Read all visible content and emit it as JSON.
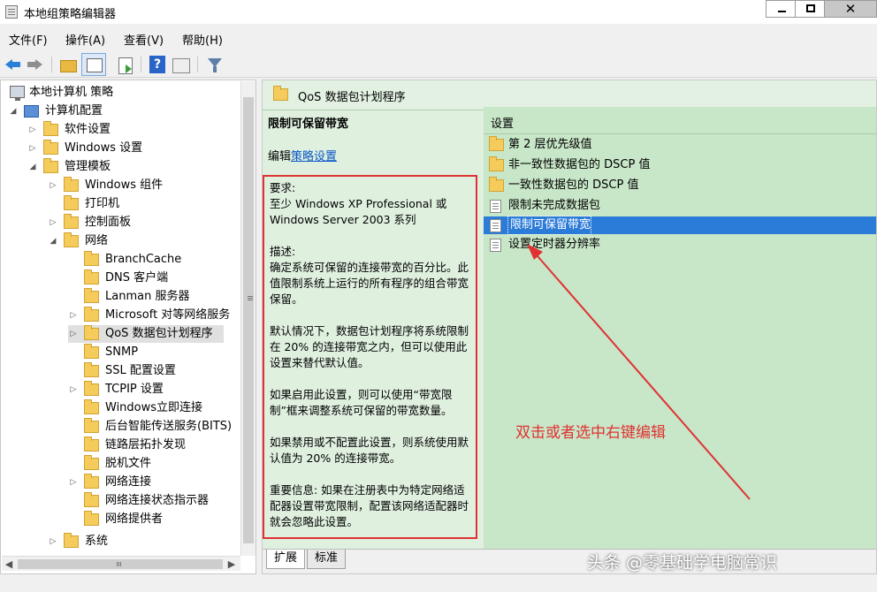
{
  "window": {
    "title": "本地组策略编辑器",
    "minimize_glyph": "—",
    "maximize_glyph": "□",
    "close_glyph": "✕"
  },
  "menu": [
    "文件(F)",
    "操作(A)",
    "查看(V)",
    "帮助(H)"
  ],
  "tree": {
    "items": [
      {
        "label": "本地计算机 策略",
        "twisty": ""
      },
      {
        "label": "计算机配置",
        "twisty": "◢"
      },
      {
        "label": "软件设置",
        "twisty": "▷"
      },
      {
        "label": "Windows 设置",
        "twisty": "▷"
      },
      {
        "label": "管理模板",
        "twisty": "◢"
      },
      {
        "label": "Windows 组件",
        "twisty": "▷"
      },
      {
        "label": "打印机",
        "twisty": ""
      },
      {
        "label": "控制面板",
        "twisty": "▷"
      },
      {
        "label": "网络",
        "twisty": "◢"
      },
      {
        "label": "BranchCache",
        "twisty": ""
      },
      {
        "label": "DNS 客户端",
        "twisty": ""
      },
      {
        "label": "Lanman 服务器",
        "twisty": ""
      },
      {
        "label": "Microsoft 对等网络服务",
        "twisty": "▷"
      },
      {
        "label": "QoS 数据包计划程序",
        "twisty": "▷"
      },
      {
        "label": "SNMP",
        "twisty": ""
      },
      {
        "label": "SSL 配置设置",
        "twisty": ""
      },
      {
        "label": "TCPIP 设置",
        "twisty": "▷"
      },
      {
        "label": "Windows立即连接",
        "twisty": ""
      },
      {
        "label": "后台智能传送服务(BITS)",
        "twisty": ""
      },
      {
        "label": "链路层拓扑发现",
        "twisty": ""
      },
      {
        "label": "脱机文件",
        "twisty": ""
      },
      {
        "label": "网络连接",
        "twisty": "▷"
      },
      {
        "label": "网络连接状态指示器",
        "twisty": ""
      },
      {
        "label": "网络提供者",
        "twisty": ""
      },
      {
        "label": "系统",
        "twisty": "▷"
      }
    ],
    "scroll_left": "◀",
    "scroll_right": "▶"
  },
  "right": {
    "header_title": "QoS 数据包计划程序",
    "desc_title": "限制可保留带宽",
    "edit_prefix": "编辑",
    "edit_link": "策略设置",
    "desc_paragraphs": [
      "要求:\n至少 Windows XP Professional 或 Windows Server 2003 系列",
      "描述:\n确定系统可保留的连接带宽的百分比。此值限制系统上运行的所有程序的组合带宽保留。",
      "默认情况下，数据包计划程序将系统限制在 20% 的连接带宽之内，但可以使用此设置来替代默认值。",
      "如果启用此设置，则可以使用“带宽限制”框来调整系统可保留的带宽数量。",
      "如果禁用或不配置此设置，则系统使用默认值为 20% 的连接带宽。",
      "重要信息: 如果在注册表中为特定网络适配器设置带宽限制，配置该网络适配器时就会忽略此设置。"
    ],
    "column_header": "设置",
    "list": [
      {
        "label": "第 2 层优先级值",
        "type": "folder"
      },
      {
        "label": "非一致性数据包的 DSCP 值",
        "type": "folder"
      },
      {
        "label": "一致性数据包的 DSCP 值",
        "type": "folder"
      },
      {
        "label": "限制未完成数据包",
        "type": "policy"
      },
      {
        "label": "限制可保留带宽",
        "type": "policy"
      },
      {
        "label": "设置定时器分辨率",
        "type": "policy"
      }
    ],
    "annotation": "双击或者选中右键编辑",
    "tabs": [
      "扩展",
      "标准"
    ]
  },
  "watermark": "头条 @零基础学电脑常识",
  "colors": {
    "annotation_red": "#e03232",
    "selection_blue": "#2b7bd8",
    "pane_green": "#c8e6c8"
  }
}
